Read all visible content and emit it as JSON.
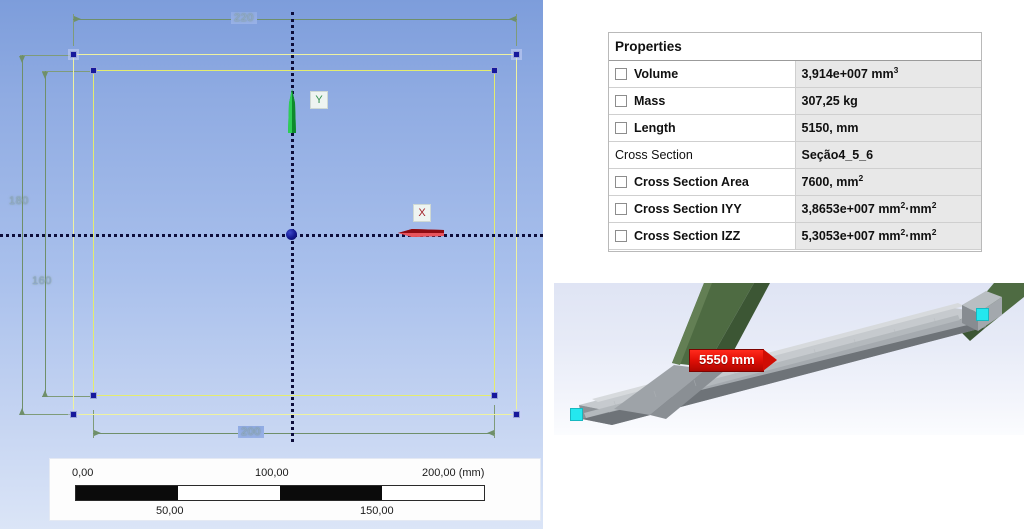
{
  "sketch": {
    "name": "sketch-viewport",
    "dimensions": {
      "top": "220",
      "bottom": "200",
      "left_outer": "180",
      "left_inner": "160"
    },
    "axes": {
      "x_label": "X",
      "y_label": "Y"
    }
  },
  "scalebar": {
    "unit_suffix": "(mm)",
    "ticks_top": [
      "0,00",
      "100,00",
      "200,00"
    ],
    "ticks_bottom": [
      "50,00",
      "150,00"
    ],
    "top_right_full": "200,00 (mm)",
    "segments": [
      1,
      0,
      1,
      0
    ]
  },
  "properties": {
    "title": "Properties",
    "rows": [
      {
        "checkbox": true,
        "label": "Volume",
        "value": "3,914e+007 mm",
        "sup": "3"
      },
      {
        "checkbox": true,
        "label": "Mass",
        "value": "307,25 kg",
        "sup": ""
      },
      {
        "checkbox": true,
        "label": "Length",
        "value": "5150, mm",
        "sup": ""
      },
      {
        "checkbox": false,
        "label": "Cross Section",
        "value": "Seção4_5_6",
        "sup": ""
      },
      {
        "checkbox": true,
        "label": "Cross Section Area",
        "value": "7600, mm",
        "sup": "2"
      },
      {
        "checkbox": true,
        "label": "Cross Section IYY",
        "value": "3,8653e+007 mm",
        "sup": "2",
        "value_tail": "·mm",
        "sup_tail": "2"
      },
      {
        "checkbox": true,
        "label": "Cross Section IZZ",
        "value": "5,3053e+007 mm",
        "sup": "2",
        "value_tail": "·mm",
        "sup_tail": "2"
      }
    ]
  },
  "preview": {
    "name": "beam-3d-preview",
    "measurement_tooltip": "5550 mm"
  },
  "colors": {
    "tooltip_red": "#d00d04",
    "endcap_cyan": "#24e8ef",
    "sketch_yellow": "#e4ec6e",
    "dim_green": "#6f8f6a",
    "origin_blue": "#12188f",
    "y_axis_green": "#2f8f4e",
    "x_axis_red": "#a3222a"
  }
}
